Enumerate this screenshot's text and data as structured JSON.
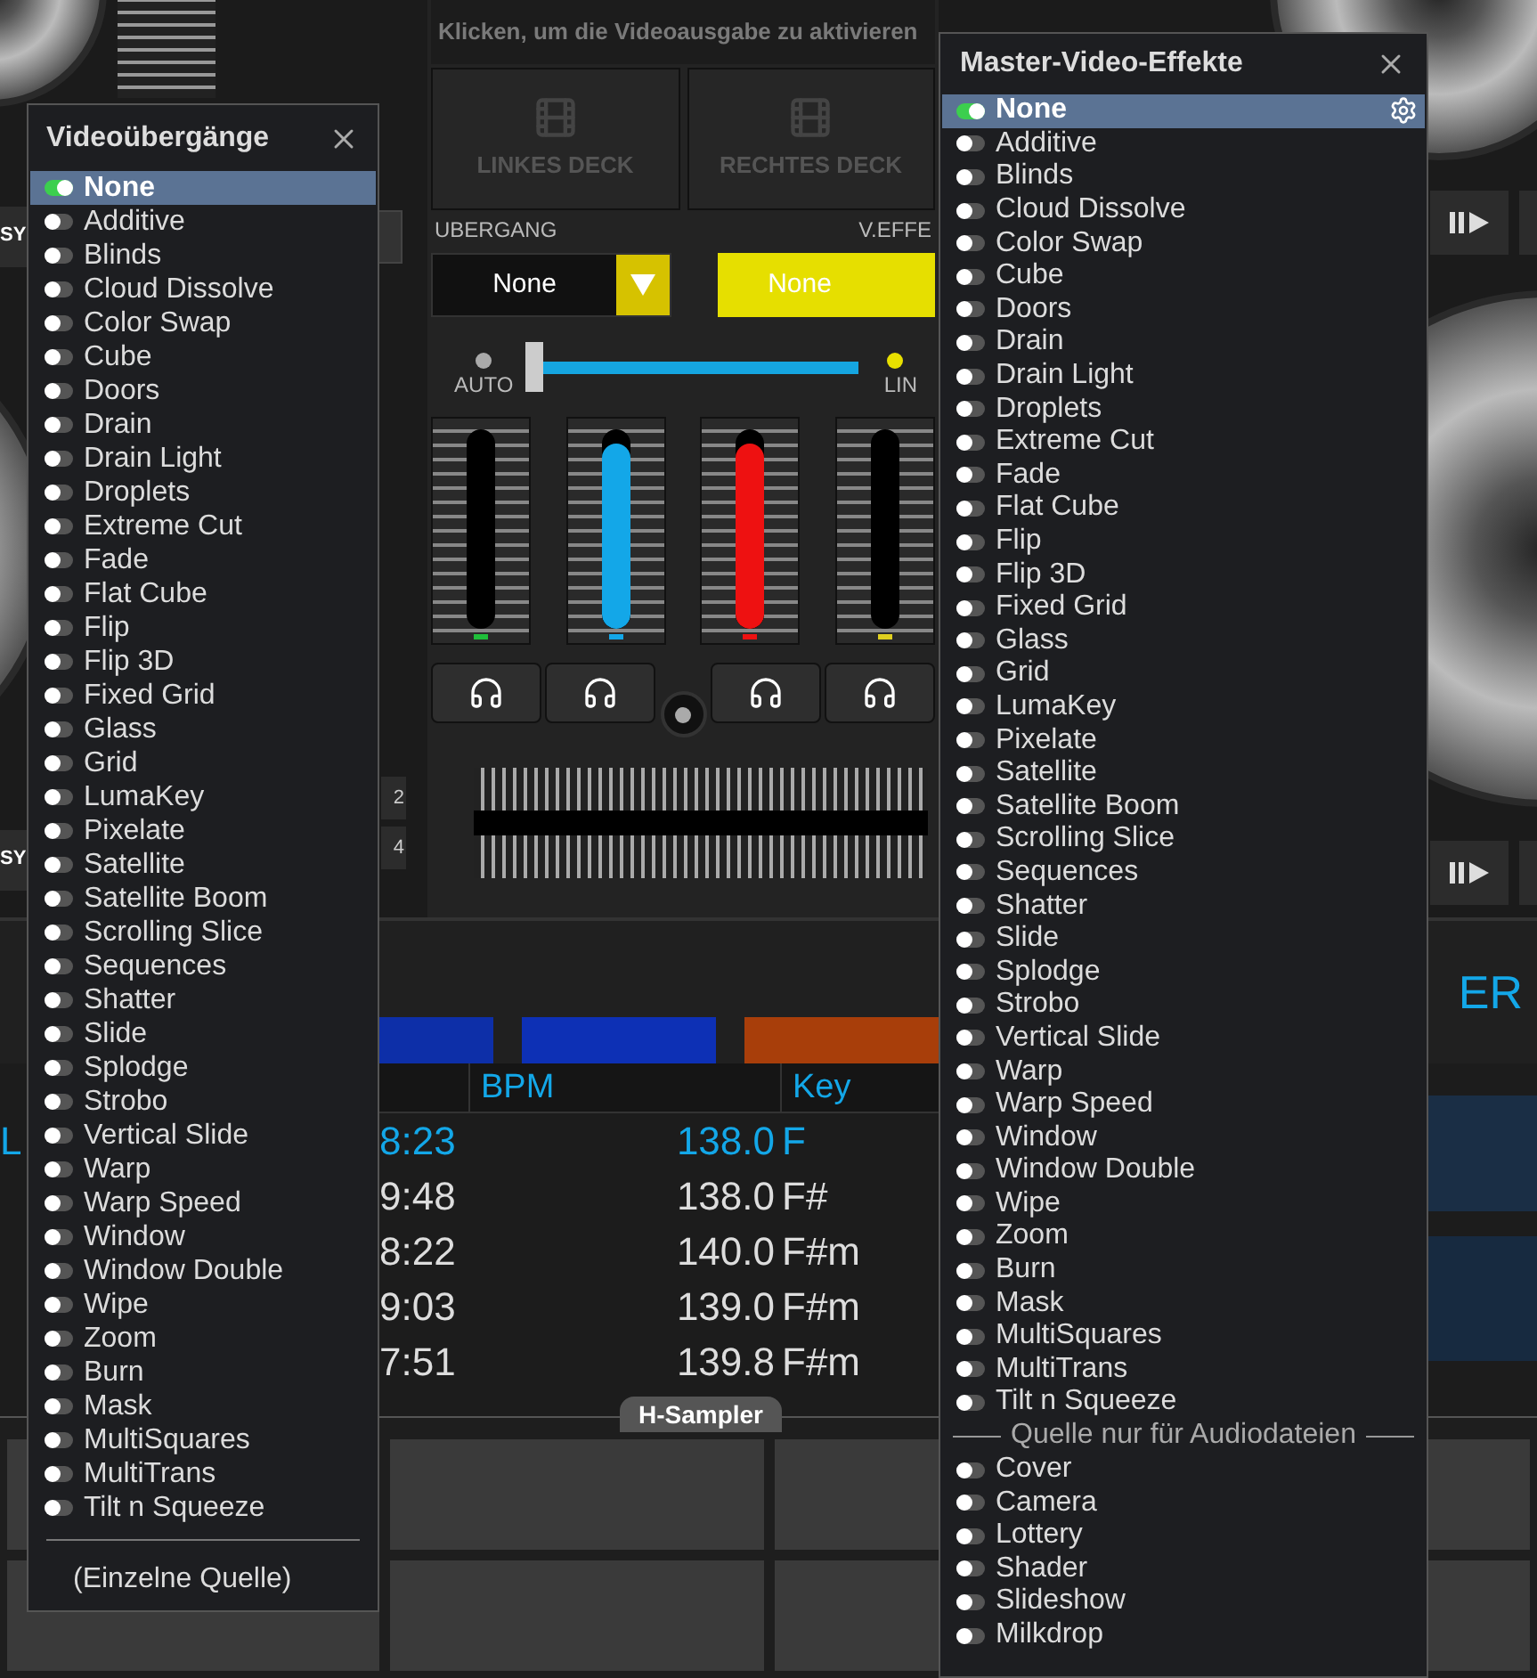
{
  "video_output_hint": "Klicken, um die Videoausgabe zu aktivieren",
  "deck_buttons": [
    "LINKES DECK",
    "RECHTES DECK"
  ],
  "transition": {
    "label": "UBERGANG",
    "value": "None"
  },
  "video_effect": {
    "label": "V.EFFE",
    "value": "None"
  },
  "video_fader": {
    "auto_label": "AUTO",
    "auto_on": false,
    "line_label": "LIN",
    "line_on": true,
    "level": 0
  },
  "meters": [
    {
      "level": 0,
      "color": "#1fbf3a"
    },
    {
      "level": 0.93,
      "color": "#13a7e8"
    },
    {
      "level": 0.93,
      "color": "#ee1111"
    },
    {
      "level": 0,
      "color": "#e0d020"
    }
  ],
  "left_sync_buttons": [
    "SY",
    "SY"
  ],
  "small_buttons": [
    "2",
    "4"
  ],
  "right_strip_text": "ER",
  "browser": {
    "columns": [
      "BPM",
      "Key"
    ],
    "rows": [
      {
        "title": "L",
        "time": "8:23",
        "bpm": "138.0",
        "key": "F",
        "selected": true
      },
      {
        "time": "9:48",
        "bpm": "138.0",
        "key": "F#",
        "selected": false
      },
      {
        "time": "8:22",
        "bpm": "140.0",
        "key": "F#m",
        "selected": false
      },
      {
        "time": "9:03",
        "bpm": "139.0",
        "key": "F#m",
        "selected": false
      },
      {
        "time": "7:51",
        "bpm": "139.8",
        "key": "F#m",
        "selected": false
      }
    ]
  },
  "sampler_tab": "H-Sampler",
  "transitions_menu": {
    "title": "Videoübergänge",
    "items": [
      {
        "label": "None",
        "selected": true
      },
      {
        "label": "Additive",
        "selected": false
      },
      {
        "label": "Blinds",
        "selected": false
      },
      {
        "label": "Cloud Dissolve",
        "selected": false
      },
      {
        "label": "Color Swap",
        "selected": false
      },
      {
        "label": "Cube",
        "selected": false
      },
      {
        "label": "Doors",
        "selected": false
      },
      {
        "label": "Drain",
        "selected": false
      },
      {
        "label": "Drain Light",
        "selected": false
      },
      {
        "label": "Droplets",
        "selected": false
      },
      {
        "label": "Extreme Cut",
        "selected": false
      },
      {
        "label": "Fade",
        "selected": false
      },
      {
        "label": "Flat Cube",
        "selected": false
      },
      {
        "label": "Flip",
        "selected": false
      },
      {
        "label": "Flip 3D",
        "selected": false
      },
      {
        "label": "Fixed Grid",
        "selected": false
      },
      {
        "label": "Glass",
        "selected": false
      },
      {
        "label": "Grid",
        "selected": false
      },
      {
        "label": "LumaKey",
        "selected": false
      },
      {
        "label": "Pixelate",
        "selected": false
      },
      {
        "label": "Satellite",
        "selected": false
      },
      {
        "label": "Satellite Boom",
        "selected": false
      },
      {
        "label": "Scrolling Slice",
        "selected": false
      },
      {
        "label": "Sequences",
        "selected": false
      },
      {
        "label": "Shatter",
        "selected": false
      },
      {
        "label": "Slide",
        "selected": false
      },
      {
        "label": "Splodge",
        "selected": false
      },
      {
        "label": "Strobo",
        "selected": false
      },
      {
        "label": "Vertical Slide",
        "selected": false
      },
      {
        "label": "Warp",
        "selected": false
      },
      {
        "label": "Warp Speed",
        "selected": false
      },
      {
        "label": "Window",
        "selected": false
      },
      {
        "label": "Window Double",
        "selected": false
      },
      {
        "label": "Wipe",
        "selected": false
      },
      {
        "label": "Zoom",
        "selected": false
      },
      {
        "label": "Burn",
        "selected": false
      },
      {
        "label": "Mask",
        "selected": false
      },
      {
        "label": "MultiSquares",
        "selected": false
      },
      {
        "label": "MultiTrans",
        "selected": false
      },
      {
        "label": "Tilt n Squeeze",
        "selected": false
      }
    ],
    "footer": "(Einzelne Quelle)"
  },
  "effects_menu": {
    "title": "Master-Video-Effekte",
    "items": [
      {
        "label": "None",
        "selected": true
      },
      {
        "label": "Additive",
        "selected": false
      },
      {
        "label": "Blinds",
        "selected": false
      },
      {
        "label": "Cloud Dissolve",
        "selected": false
      },
      {
        "label": "Color Swap",
        "selected": false
      },
      {
        "label": "Cube",
        "selected": false
      },
      {
        "label": "Doors",
        "selected": false
      },
      {
        "label": "Drain",
        "selected": false
      },
      {
        "label": "Drain Light",
        "selected": false
      },
      {
        "label": "Droplets",
        "selected": false
      },
      {
        "label": "Extreme Cut",
        "selected": false
      },
      {
        "label": "Fade",
        "selected": false
      },
      {
        "label": "Flat Cube",
        "selected": false
      },
      {
        "label": "Flip",
        "selected": false
      },
      {
        "label": "Flip 3D",
        "selected": false
      },
      {
        "label": "Fixed Grid",
        "selected": false
      },
      {
        "label": "Glass",
        "selected": false
      },
      {
        "label": "Grid",
        "selected": false
      },
      {
        "label": "LumaKey",
        "selected": false
      },
      {
        "label": "Pixelate",
        "selected": false
      },
      {
        "label": "Satellite",
        "selected": false
      },
      {
        "label": "Satellite Boom",
        "selected": false
      },
      {
        "label": "Scrolling Slice",
        "selected": false
      },
      {
        "label": "Sequences",
        "selected": false
      },
      {
        "label": "Shatter",
        "selected": false
      },
      {
        "label": "Slide",
        "selected": false
      },
      {
        "label": "Splodge",
        "selected": false
      },
      {
        "label": "Strobo",
        "selected": false
      },
      {
        "label": "Vertical Slide",
        "selected": false
      },
      {
        "label": "Warp",
        "selected": false
      },
      {
        "label": "Warp Speed",
        "selected": false
      },
      {
        "label": "Window",
        "selected": false
      },
      {
        "label": "Window Double",
        "selected": false
      },
      {
        "label": "Wipe",
        "selected": false
      },
      {
        "label": "Zoom",
        "selected": false
      },
      {
        "label": "Burn",
        "selected": false
      },
      {
        "label": "Mask",
        "selected": false
      },
      {
        "label": "MultiSquares",
        "selected": false
      },
      {
        "label": "MultiTrans",
        "selected": false
      },
      {
        "label": "Tilt n Squeeze",
        "selected": false
      }
    ],
    "section": "Quelle nur für Audiodateien",
    "audio_items": [
      {
        "label": "Cover",
        "selected": false
      },
      {
        "label": "Camera",
        "selected": false
      },
      {
        "label": "Lottery",
        "selected": false
      },
      {
        "label": "Shader",
        "selected": false
      },
      {
        "label": "Slideshow",
        "selected": false
      },
      {
        "label": "Milkdrop",
        "selected": false
      }
    ]
  }
}
